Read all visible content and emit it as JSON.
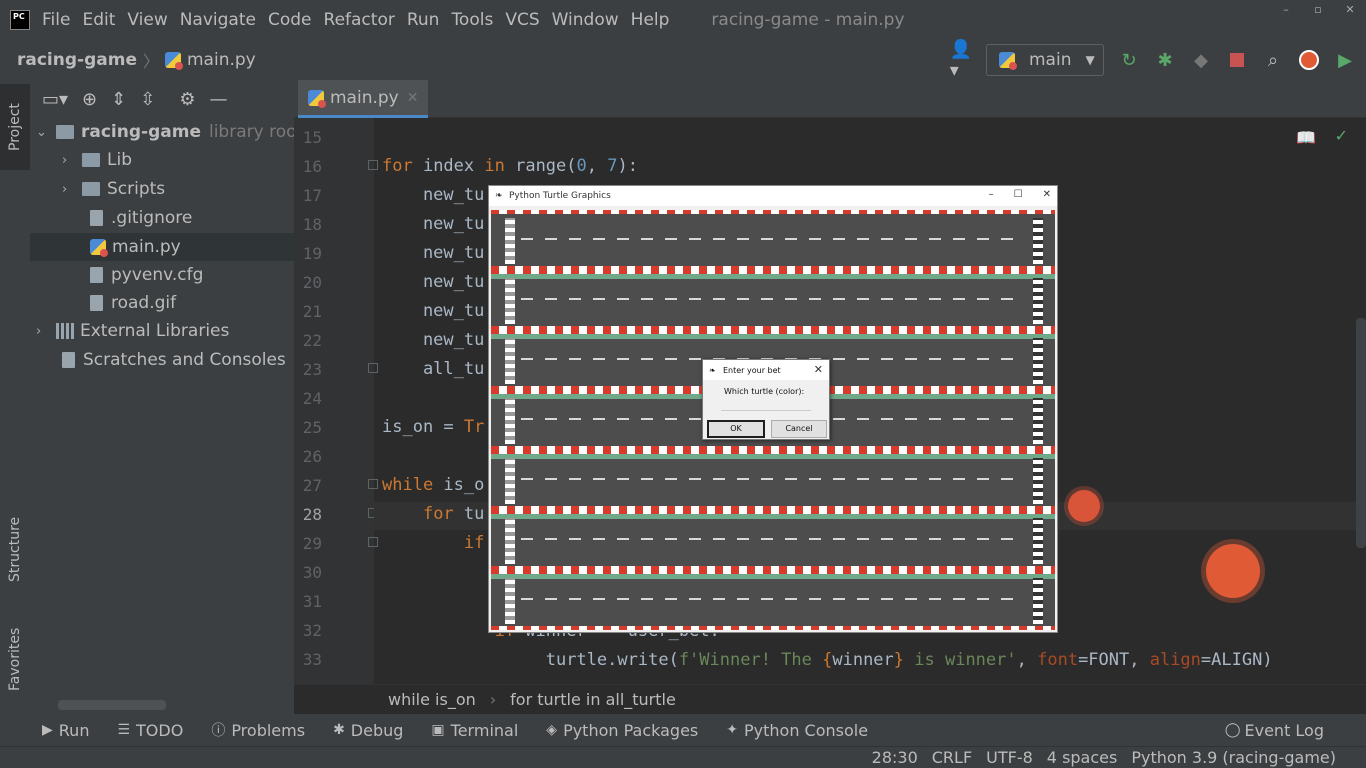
{
  "menubar": {
    "logo": "PC",
    "items": [
      "File",
      "Edit",
      "View",
      "Navigate",
      "Code",
      "Refactor",
      "Run",
      "Tools",
      "VCS",
      "Window",
      "Help"
    ],
    "title": "racing-game - main.py",
    "minimize": "–",
    "maximize": "▫",
    "close": "✕"
  },
  "toolbar": {
    "project": "racing-game",
    "file": "main.py",
    "run_config": "main"
  },
  "left_strip": {
    "project_tab": "Project",
    "structure_tab": "Structure",
    "favorites_tab": "Favorites"
  },
  "project_tree": {
    "root": "racing-game",
    "root_note": "library root,",
    "items": [
      {
        "label": "Lib"
      },
      {
        "label": "Scripts"
      },
      {
        "label": ".gitignore"
      },
      {
        "label": "main.py"
      },
      {
        "label": "pyvenv.cfg"
      },
      {
        "label": "road.gif"
      },
      {
        "label": "External Libraries"
      },
      {
        "label": "Scratches and Consoles"
      }
    ]
  },
  "editor": {
    "tab": "main.py",
    "line_numbers": [
      "15",
      "16",
      "17",
      "18",
      "19",
      "20",
      "21",
      "22",
      "23",
      "24",
      "25",
      "26",
      "27",
      "28",
      "29",
      "30",
      "31",
      "32",
      "33"
    ],
    "current_line": "28"
  },
  "editor_crumb": {
    "part1": "while is_on",
    "part2": "for turtle in all_turtle"
  },
  "turtle_window": {
    "title": "Python Turtle Graphics",
    "controls": [
      "–",
      "☐",
      "✕"
    ]
  },
  "dialog": {
    "title": "Enter your bet",
    "label": "Which turtle (color):",
    "input_value": "",
    "ok": "OK",
    "cancel": "Cancel",
    "close": "✕"
  },
  "bottom_tools": {
    "run": "Run",
    "todo": "TODO",
    "problems": "Problems",
    "debug": "Debug",
    "terminal": "Terminal",
    "python_packages": "Python Packages",
    "python_console": "Python Console",
    "event_log": "Event Log"
  },
  "statusbar": {
    "position": "28:30",
    "line_sep": "CRLF",
    "encoding": "UTF-8",
    "indent": "4 spaces",
    "interpreter": "Python 3.9 (racing-game)"
  },
  "colors": {
    "accent": "#4a88c7",
    "keyword": "#cc7832",
    "number": "#6897bb",
    "string": "#6a8759",
    "cursor": "#e05a36"
  }
}
